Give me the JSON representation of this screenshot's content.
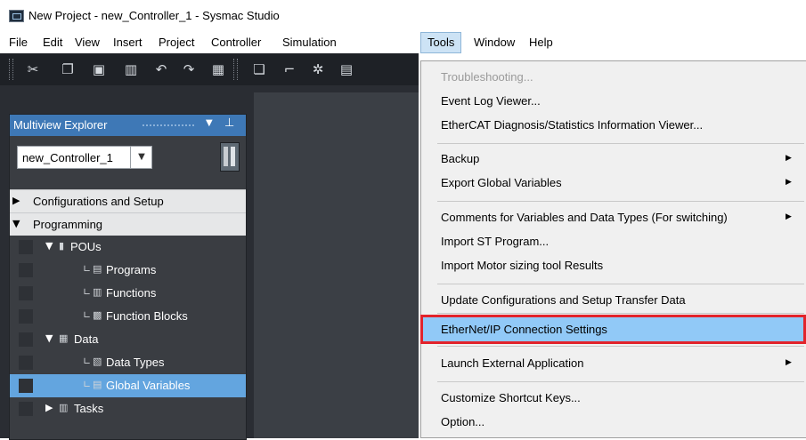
{
  "window": {
    "title": "New Project - new_Controller_1 - Sysmac Studio"
  },
  "menubar": {
    "items": [
      {
        "id": "file",
        "label": "File"
      },
      {
        "id": "edit",
        "label": "Edit"
      },
      {
        "id": "view",
        "label": "View"
      },
      {
        "id": "insert",
        "label": "Insert"
      },
      {
        "id": "project",
        "label": "Project"
      },
      {
        "id": "controller",
        "label": "Controller"
      },
      {
        "id": "simulation",
        "label": "Simulation"
      },
      {
        "id": "tools",
        "label": "Tools",
        "active": true
      },
      {
        "id": "window",
        "label": "Window"
      },
      {
        "id": "help",
        "label": "Help"
      }
    ]
  },
  "toolbar": {
    "icons": [
      "cut-icon",
      "copy-icon",
      "paste-icon",
      "delete-icon",
      "undo-icon",
      "redo-icon",
      "help-icon",
      "window-icon",
      "build-icon",
      "tools-icon",
      "monitor-icon"
    ]
  },
  "explorer": {
    "title": "Multiview Explorer",
    "controller": "new_Controller_1",
    "tree": {
      "config": "Configurations and Setup",
      "programming": "Programming",
      "pous": "POUs",
      "programs": "Programs",
      "functions": "Functions",
      "function_blocks": "Function Blocks",
      "data": "Data",
      "data_types": "Data Types",
      "global_variables": "Global Variables",
      "tasks": "Tasks"
    }
  },
  "tools_menu": {
    "troubleshooting": "Troubleshooting...",
    "event_log": "Event Log Viewer...",
    "ethercat_diag": "EtherCAT Diagnosis/Statistics Information Viewer...",
    "backup": "Backup",
    "export_globals": "Export Global Variables",
    "comments": "Comments for Variables and Data Types (For switching)",
    "import_st": "Import ST Program...",
    "import_motor": "Import Motor sizing tool Results",
    "update_config": "Update Configurations and Setup Transfer Data",
    "ethernet_ip": "EtherNet/IP Connection Settings",
    "launch_external": "Launch External Application",
    "customize_keys": "Customize Shortcut Keys...",
    "option": "Option..."
  },
  "colors": {
    "menu_highlight": "#91c9f7",
    "callout_border": "#e2232b",
    "explorer_header": "#3e78b6",
    "selected_tree_item": "#63a5df"
  }
}
